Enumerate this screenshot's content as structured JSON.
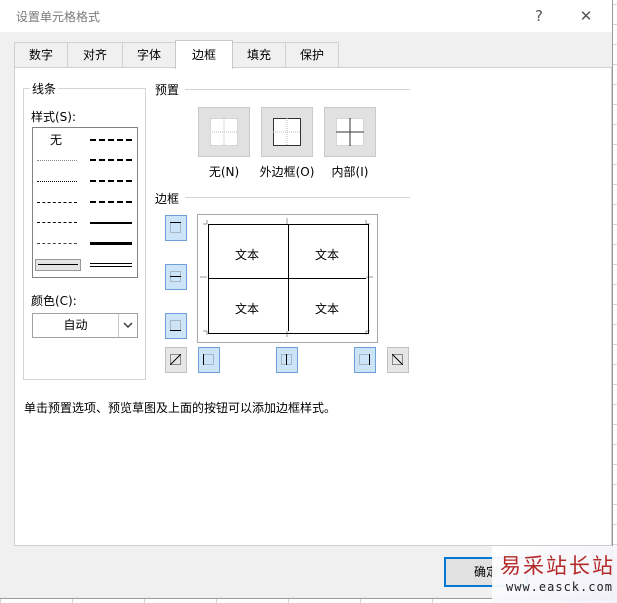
{
  "dialog": {
    "title": "设置单元格格式",
    "help_label": "?",
    "close_label": "✕"
  },
  "tabs": [
    "数字",
    "对齐",
    "字体",
    "边框",
    "填充",
    "保护"
  ],
  "active_tab": "边框",
  "line": {
    "group_label": "线条",
    "style_label": "样式(S):",
    "none_label": "无",
    "color_label": "颜色(C):",
    "color_value": "自动"
  },
  "presets": {
    "section_label": "预置",
    "items": [
      {
        "label": "无(N)"
      },
      {
        "label": "外边框(O)"
      },
      {
        "label": "内部(I)"
      }
    ]
  },
  "border": {
    "section_label": "边框",
    "preview_texts": [
      "文本",
      "文本",
      "文本",
      "文本"
    ]
  },
  "hint": "单击预置选项、预览草图及上面的按钮可以添加边框样式。",
  "buttons": {
    "ok_label": "确定"
  },
  "watermark": {
    "text": "易采站长站",
    "url": "www.easck.com"
  },
  "colors": {
    "accent": "#0078d7",
    "button_on_bg": "#cce4f7",
    "button_on_border": "#6f9ed8",
    "watermark_red": "#b52a2a"
  }
}
